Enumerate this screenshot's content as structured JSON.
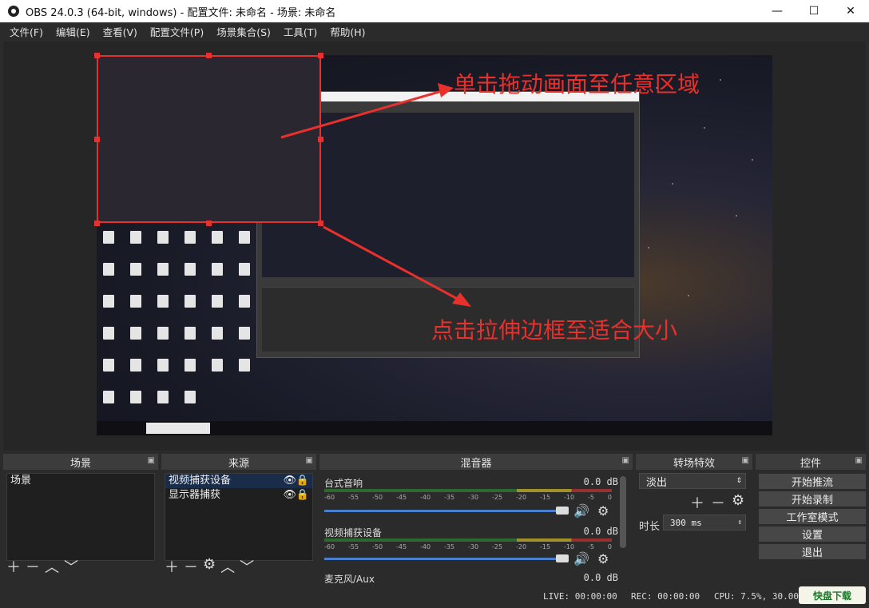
{
  "window": {
    "title": "OBS 24.0.3 (64-bit, windows) - 配置文件: 未命名 - 场景: 未命名",
    "minimize": "—",
    "maximize": "☐",
    "close": "✕"
  },
  "menu": [
    "文件(F)",
    "编辑(E)",
    "查看(V)",
    "配置文件(P)",
    "场景集合(S)",
    "工具(T)",
    "帮助(H)"
  ],
  "annotations": {
    "drag": "单击拖动画面至任意区域",
    "resize": "点击拉伸边框至适合大小",
    "color": "#e8302c"
  },
  "docks": {
    "scenes": {
      "title": "场景",
      "items": [
        "场景"
      ]
    },
    "sources": {
      "title": "来源",
      "items": [
        "视频捕获设备",
        "显示器捕获"
      ]
    },
    "mixer": {
      "title": "混音器",
      "channels": [
        {
          "name": "台式音响",
          "db": "0.0 dB"
        },
        {
          "name": "视频捕获设备",
          "db": "0.0 dB"
        },
        {
          "name": "麦克风/Aux",
          "db": "0.0 dB"
        }
      ],
      "ticks": [
        "-60",
        "-55",
        "-50",
        "-45",
        "-40",
        "-35",
        "-30",
        "-25",
        "-20",
        "-15",
        "-10",
        "-5",
        "0"
      ]
    },
    "transitions": {
      "title": "转场特效",
      "selected": "淡出",
      "duration_label": "时长",
      "duration": "300 ms"
    },
    "controls": {
      "title": "控件",
      "buttons": [
        "开始推流",
        "开始录制",
        "工作室模式",
        "设置",
        "退出"
      ]
    }
  },
  "status": {
    "live": "LIVE: 00:00:00",
    "rec": "REC: 00:00:00",
    "cpu": "CPU: 7.5%, 30.00 f"
  },
  "watermark": "快盘下载"
}
